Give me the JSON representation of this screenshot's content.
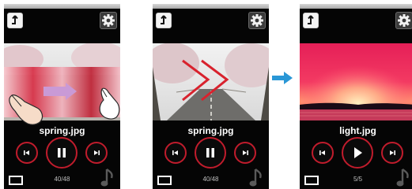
{
  "screens": [
    {
      "filename": "spring.jpg",
      "counter": "40/48",
      "play_state": "pause",
      "image": "cherry-blossom-road",
      "overlay": "swipe-gesture-hand"
    },
    {
      "filename": "spring.jpg",
      "counter": "40/48",
      "play_state": "pause",
      "image": "cherry-blossom-road",
      "overlay": "red-chevrons"
    },
    {
      "filename": "light.jpg",
      "counter": "5/5",
      "play_state": "play",
      "image": "sunset-sky",
      "overlay": "none"
    }
  ],
  "icons": {
    "back": "back-arrow-icon",
    "settings": "gear-icon",
    "prev": "skip-previous-icon",
    "next": "skip-next-icon",
    "pause": "pause-icon",
    "play": "play-icon",
    "display": "screen-mode-icon",
    "music": "music-note-icon",
    "transition": "right-arrow-icon"
  },
  "colors": {
    "accent_red": "#c01c2c",
    "arrow_blue": "#2a97d6",
    "background": "#050505"
  }
}
